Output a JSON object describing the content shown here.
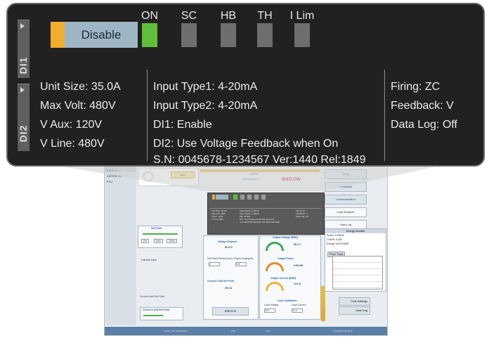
{
  "callout": {
    "disable_button": "Disable",
    "side_tabs": [
      "DI1",
      "DI2"
    ],
    "indicators": [
      {
        "label": "ON",
        "state": "on",
        "color": "#5fbf3a"
      },
      {
        "label": "SC",
        "state": "off",
        "color": "#6e6e6e"
      },
      {
        "label": "HB",
        "state": "off",
        "color": "#6e6e6e"
      },
      {
        "label": "TH",
        "state": "off",
        "color": "#6e6e6e"
      },
      {
        "label": "I Lim",
        "state": "off",
        "color": "#6e6e6e"
      }
    ],
    "info_left": [
      "Unit Size: 35.0A",
      "Max Volt: 480V",
      "V Aux: 120V",
      "V Line: 480V"
    ],
    "info_middle": [
      "Input Type1: 4-20mA",
      "Input Type2: 4-20mA",
      "DI1: Enable",
      "DI2: Use Voltage Feedback when On",
      "S.N: 0045678-1234567 Ver:1440 Rel:1849"
    ],
    "info_right": [
      "Firing: ZC",
      "Feedback: V",
      "Data Log: Off"
    ]
  },
  "background_app": {
    "brand_logo": "WATLOW",
    "nav_items": [
      "ASPIRE",
      "ASPIRE SN",
      "PSU"
    ],
    "header_center": "ASPIRE",
    "access_level": "Access Level: 3",
    "reset_button": "Reset",
    "right_buttons": [
      "Firing",
      "Feedback",
      "Communication",
      "Load Analyzer",
      "Data Log"
    ],
    "set_point": {
      "title": "Set Point",
      "options": [
        "0%",
        "50%",
        "100%"
      ]
    },
    "external_input": "External Input",
    "current_limit_set_point_label": "Current Limit Set Point",
    "current_limit_title": "Current Limit Set Point",
    "voltage_request": {
      "title": "Voltage Request",
      "value": "50.0 %"
    },
    "soft_start_label": "Soft Start Time(x10ms)",
    "soft_start_value": "1",
    "output_scaling_label": "Output Scaling(%)",
    "output_scaling_value": "100",
    "current_limit_value": "29.4 A",
    "bakeout_button": "Bakeout",
    "output_voltage": {
      "title": "Output Voltage (RMS)",
      "value": "59.2 V"
    },
    "output_power": {
      "title": "Output Power",
      "value": "0.96 kW"
    },
    "output_current": {
      "title": "Output Current (RMS)",
      "value": "14.0 A"
    },
    "load_calibration": {
      "title": "Load Calibration",
      "voltage_label": "Load Voltage",
      "voltage_value": "119",
      "current_label": "Load Current",
      "current_value": "21.4"
    },
    "energy_monitor": {
      "title": "Energy Monitor",
      "power": "Power: 0.00kVA",
      "power2": "0.00kW",
      "cos_phi": "CosPhi: 0.000",
      "energy_total": "Energy Tot:00.0kWh",
      "reset_totals": "Reset Totals"
    },
    "feat_settings_button": "Feat Settings",
    "save_img_button": "Save Img",
    "status_bar": [
      "Power: Out of (ON/OFF)",
      "kWh",
      "kVA",
      "17/05/2019 04:08:00"
    ]
  }
}
